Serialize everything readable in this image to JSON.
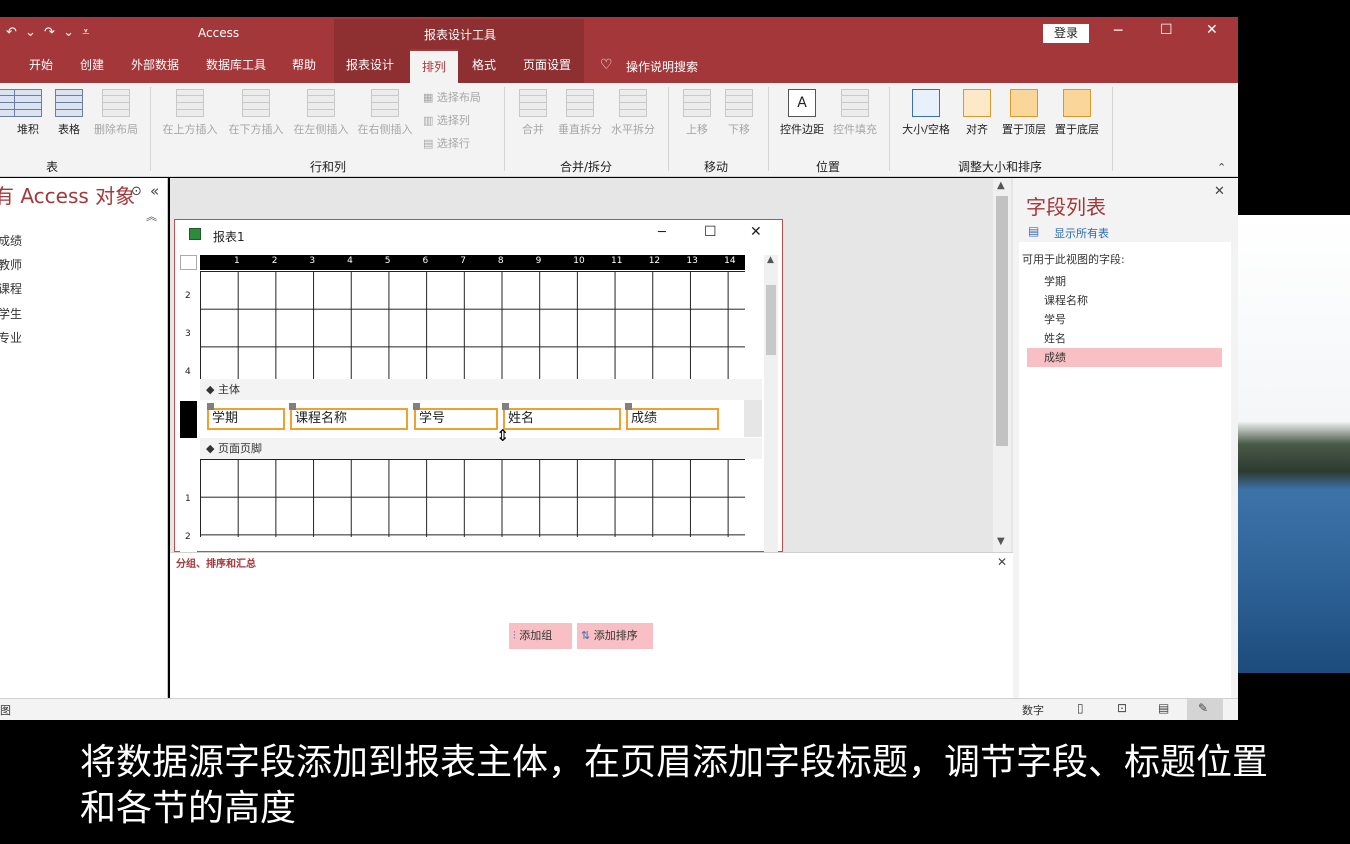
{
  "titlebar": {
    "quick_access": "↶ ⌄ ↷ ⌄ ⩡",
    "app_name": "Access",
    "context_tool": "报表设计工具",
    "login_label": "登录",
    "minimize": "─",
    "maximize": "☐",
    "close": "✕"
  },
  "tabs": [
    "开始",
    "创建",
    "外部数据",
    "数据库工具",
    "帮助",
    "报表设计",
    "排列",
    "格式",
    "页面设置"
  ],
  "active_tab": "排列",
  "tell_me": "操作说明搜索",
  "ribbon": {
    "table_group": {
      "label": "表",
      "stacked": "堆积",
      "tabular": "表格",
      "remove_layout": "删除布局"
    },
    "rows_cols_group": {
      "label": "行和列",
      "insert_above": "在上方插入",
      "insert_below": "在下方插入",
      "insert_left": "在左侧插入",
      "insert_right": "在右侧插入",
      "select_layout": "选择布局",
      "select_column": "选择列",
      "select_row": "选择行"
    },
    "merge_group": {
      "label": "合并/拆分",
      "merge": "合并",
      "split_vertical": "垂直拆分",
      "split_horizontal": "水平拆分"
    },
    "move_group": {
      "label": "移动",
      "move_up": "上移",
      "move_down": "下移"
    },
    "position_group": {
      "label": "位置",
      "control_margins": "控件边距",
      "control_padding": "控件填充"
    },
    "size_group": {
      "label": "调整大小和排序",
      "size_space": "大小/空格",
      "align": "对齐",
      "bring_front": "置于顶层",
      "send_back": "置于底层"
    }
  },
  "nav": {
    "title": "有 Access 对象",
    "items": [
      "成绩",
      "教师",
      "课程",
      "学生",
      "专业"
    ]
  },
  "report": {
    "title": "报表1",
    "ruler": [
      "1",
      "2",
      "3",
      "4",
      "5",
      "6",
      "7",
      "8",
      "9",
      "10",
      "11",
      "12",
      "13",
      "14"
    ],
    "vruler_top": [
      "2",
      "3",
      "4"
    ],
    "vruler_bottom": [
      "1",
      "2"
    ],
    "section_detail": "主体",
    "section_footer": "页面页脚",
    "fields": [
      "学期",
      "课程名称",
      "学号",
      "姓名",
      "成绩"
    ]
  },
  "group_pane": {
    "title": "分组、排序和汇总",
    "add_group": "添加组",
    "add_sort": "添加排序",
    "close": "✕"
  },
  "field_list": {
    "title": "字段列表",
    "show_all": "显示所有表",
    "subtitle": "可用于此视图的字段:",
    "fields": [
      "学期",
      "课程名称",
      "学号",
      "姓名",
      "成绩"
    ],
    "selected": "成绩",
    "close": "✕"
  },
  "status": {
    "left": "图",
    "mode": "数字"
  },
  "caption": "将数据源字段添加到报表主体，在页眉添加字段标题，调节字段、标题位置和各节的高度",
  "colors": {
    "accent": "#a4373a",
    "selection": "#f0a030",
    "field_selected": "#f8c0c4"
  }
}
